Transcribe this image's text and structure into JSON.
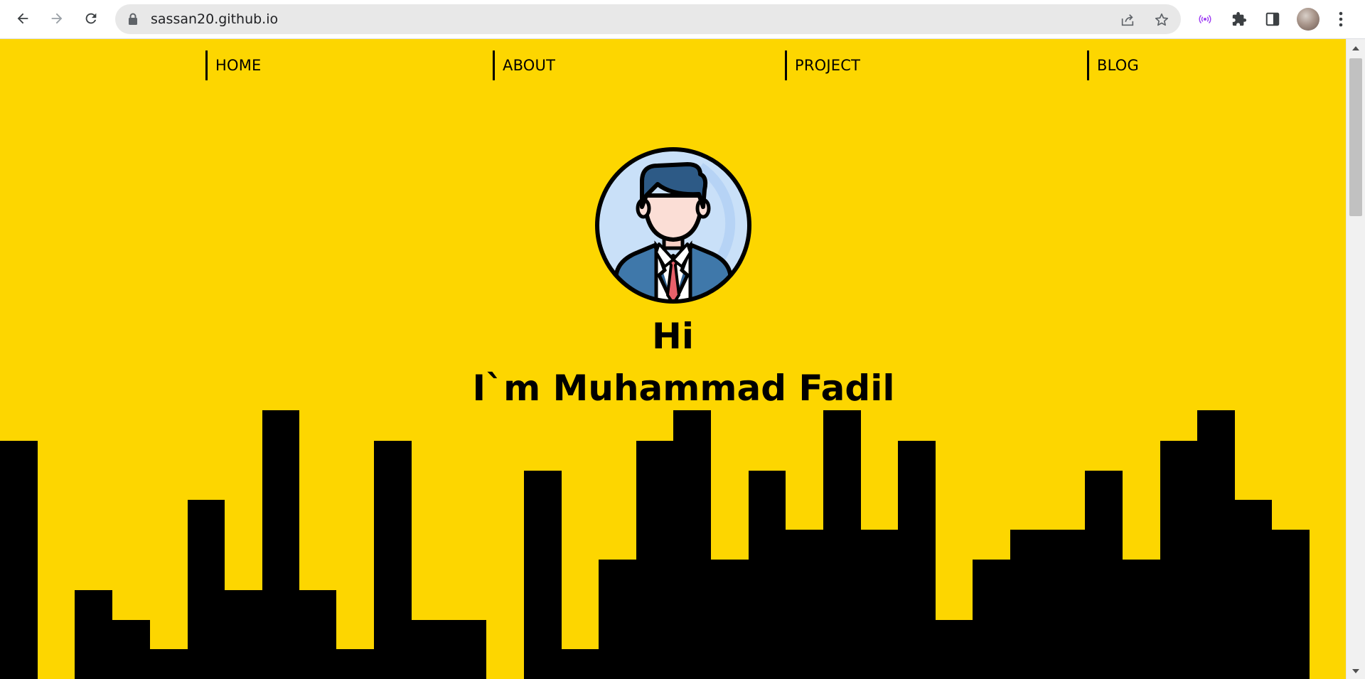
{
  "browser": {
    "url": "sassan20.github.io",
    "icons": [
      "back-icon",
      "forward-icon",
      "reload-icon",
      "lock-icon",
      "share-icon",
      "star-icon",
      "broadcast-icon",
      "extensions-icon",
      "side-panel-icon",
      "profile-avatar",
      "more-menu-icon"
    ]
  },
  "site": {
    "nav": [
      {
        "label": "HOME"
      },
      {
        "label": "ABOUT"
      },
      {
        "label": "PROJECT"
      },
      {
        "label": "BLOG"
      }
    ],
    "hero": {
      "greeting": "Hi",
      "name": "I`m Muhammad Fadil"
    },
    "colors": {
      "background": "#fdd600",
      "skyline": "#000000",
      "text": "#000000"
    }
  }
}
